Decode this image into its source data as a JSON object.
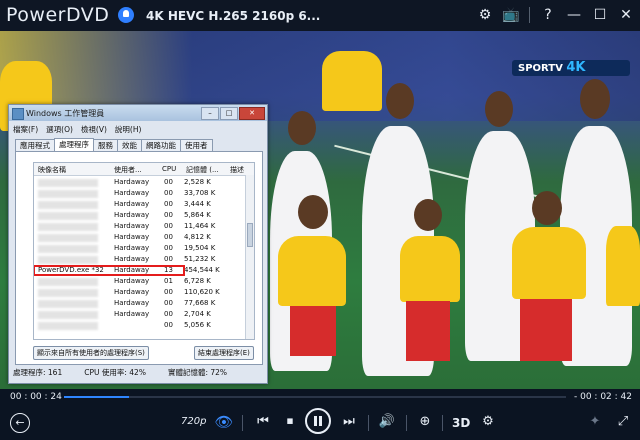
{
  "app": {
    "brand": "PowerDVD",
    "media_title": "4K HEVC H.265 2160p 6..."
  },
  "titlebar_icons": [
    "gear-icon",
    "tv-icon",
    "help-icon",
    "minimize-icon",
    "maximize-icon",
    "close-icon"
  ],
  "overlay": {
    "channel_logo": "SPORTV",
    "channel_logo_suffix": "4K"
  },
  "task_manager": {
    "title": "Windows 工作管理員",
    "menu": [
      "檔案(F)",
      "選項(O)",
      "檢視(V)",
      "說明(H)"
    ],
    "tabs": [
      "應用程式",
      "處理程序",
      "服務",
      "效能",
      "網路功能",
      "使用者"
    ],
    "active_tab": "處理程序",
    "columns": [
      "映像名稱",
      "使用者...",
      "CPU",
      "記憶體 (...",
      "描述"
    ],
    "rows": [
      {
        "name": "",
        "user": "Hardaway",
        "cpu": "00",
        "mem": "2,528 K"
      },
      {
        "name": "",
        "user": "Hardaway",
        "cpu": "00",
        "mem": "33,708 K"
      },
      {
        "name": "",
        "user": "Hardaway",
        "cpu": "00",
        "mem": "3,444 K"
      },
      {
        "name": "",
        "user": "Hardaway",
        "cpu": "00",
        "mem": "5,864 K"
      },
      {
        "name": "",
        "user": "Hardaway",
        "cpu": "00",
        "mem": "11,464 K"
      },
      {
        "name": "",
        "user": "Hardaway",
        "cpu": "00",
        "mem": "4,812 K"
      },
      {
        "name": "",
        "user": "Hardaway",
        "cpu": "00",
        "mem": "19,504 K"
      },
      {
        "name": "",
        "user": "Hardaway",
        "cpu": "00",
        "mem": "51,232 K"
      },
      {
        "name": "PowerDVD.exe *32",
        "user": "Hardaway",
        "cpu": "13",
        "mem": "454,544 K"
      },
      {
        "name": "",
        "user": "Hardaway",
        "cpu": "01",
        "mem": "6,728 K"
      },
      {
        "name": "",
        "user": "Hardaway",
        "cpu": "00",
        "mem": "110,620 K"
      },
      {
        "name": "",
        "user": "Hardaway",
        "cpu": "00",
        "mem": "77,668 K"
      },
      {
        "name": "",
        "user": "Hardaway",
        "cpu": "00",
        "mem": "2,704 K"
      },
      {
        "name": "",
        "user": "",
        "cpu": "00",
        "mem": "5,056 K"
      }
    ],
    "highlight_row_index": 8,
    "show_all_label": "顯示來自所有使用者的處理程序(S)",
    "end_process_label": "結束處理程序(E)",
    "status": {
      "processes": "處理程序: 161",
      "cpu": "CPU 使用率: 42%",
      "memory": "實體記憶體: 72%"
    }
  },
  "playback": {
    "elapsed": "00 : 00 : 24",
    "remaining": "- 00 : 02 : 42",
    "progress_fraction": 0.13,
    "quality": "720p"
  }
}
